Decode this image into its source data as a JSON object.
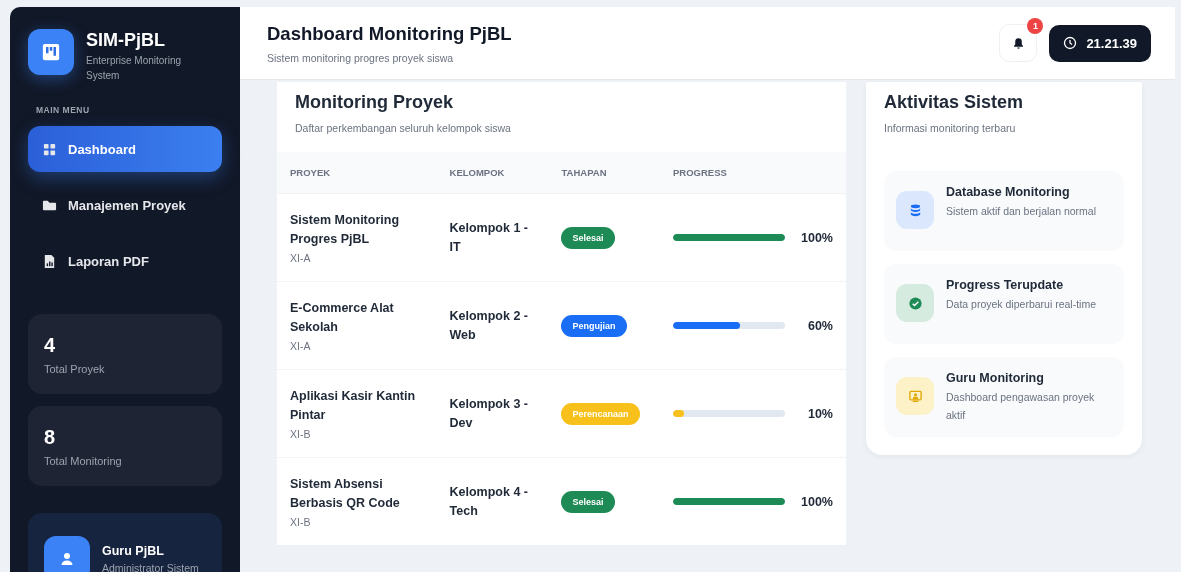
{
  "sidebar": {
    "app_name": "SIM-PjBL",
    "app_subtitle": "Enterprise Monitoring System",
    "menu_heading": "MAIN MENU",
    "items": [
      {
        "label": "Dashboard",
        "selected": true
      },
      {
        "label": "Manajemen Proyek",
        "selected": false
      },
      {
        "label": "Laporan PDF",
        "selected": false
      }
    ],
    "stats": [
      {
        "value": "4",
        "label": "Total Proyek"
      },
      {
        "value": "8",
        "label": "Total Monitoring"
      }
    ],
    "user": {
      "name": "Guru PjBL",
      "role": "Administrator Sistem"
    }
  },
  "header": {
    "title": "Dashboard Monitoring PjBL",
    "subtitle": "Sistem monitoring progres proyek siswa",
    "notification_count": "1",
    "time": "21.21.39"
  },
  "projects": {
    "title": "Monitoring Proyek",
    "subtitle": "Daftar perkembangan seluruh kelompok siswa",
    "columns": [
      "PROYEK",
      "KELOMPOK",
      "TAHAPAN",
      "PROGRESS"
    ],
    "rows": [
      {
        "name": "Sistem Monitoring Progres PjBL",
        "class": "XI-A",
        "group": "Kelompok 1 - IT",
        "stage": "Selesai",
        "color": "#1e8a55",
        "level": 1.0,
        "percent": "100%"
      },
      {
        "name": "E-Commerce Alat Sekolah",
        "class": "XI-A",
        "group": "Kelompok 2 - Web",
        "stage": "Pengujian",
        "color": "#1a6ef5",
        "level": 0.6,
        "percent": "60%"
      },
      {
        "name": "Aplikasi Kasir Kantin Pintar",
        "class": "XI-B",
        "group": "Kelompok 3 - Dev",
        "stage": "Perencanaan",
        "color": "#f7c01a",
        "level": 0.1,
        "percent": "10%"
      },
      {
        "name": "Sistem Absensi Berbasis QR Code",
        "class": "XI-B",
        "group": "Kelompok 4 - Tech",
        "stage": "Selesai",
        "color": "#1e8a55",
        "level": 1.0,
        "percent": "100%"
      }
    ]
  },
  "activity": {
    "title": "Aktivitas Sistem",
    "subtitle": "Informasi monitoring terbaru",
    "items": [
      {
        "title": "Database Monitoring",
        "text": "Sistem aktif dan berjalan normal"
      },
      {
        "title": "Progress Terupdate",
        "text": "Data proyek diperbarui real-time"
      },
      {
        "title": "Guru Monitoring",
        "text": "Dashboard pengawasan proyek aktif"
      }
    ]
  }
}
